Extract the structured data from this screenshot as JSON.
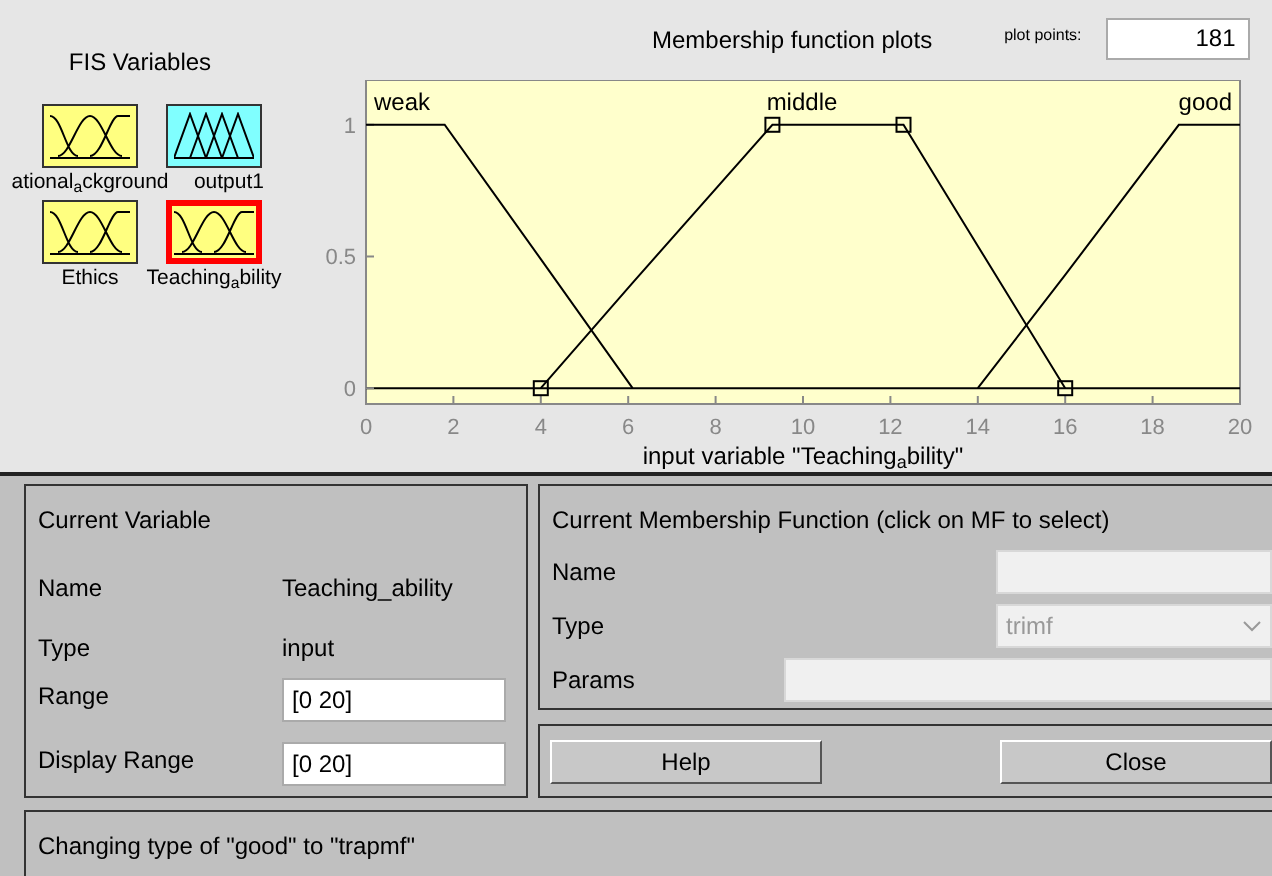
{
  "fis_variables": {
    "title": "FIS Variables",
    "items": [
      {
        "label": "ational$_{a}$ckground",
        "kind": "input",
        "selected": false
      },
      {
        "label": "output1",
        "kind": "output",
        "selected": false
      },
      {
        "label": "Ethics",
        "kind": "input",
        "selected": false
      },
      {
        "label": "Teaching$_{a}$bility",
        "kind": "input",
        "selected": true
      }
    ]
  },
  "plot": {
    "title": "Membership function plots",
    "membership_functions": [
      {
        "selected": false
      },
      {
        "selected": true
      },
      {
        "selected": false
      }
    ],
    "plot_points": {
      "label": "plot points:",
      "value": "181"
    },
    "chart_data": {
      "type": "line",
      "xlabel": "input variable \"Teaching$_{a}$bility\"",
      "x": [
        0,
        1.8,
        4,
        6.1,
        9.3,
        12.3,
        14,
        16,
        18.6,
        20
      ],
      "xlim": [
        0,
        20
      ],
      "ylim": [
        -0.06,
        1.17
      ],
      "xticks": [
        0,
        2,
        4,
        6,
        8,
        10,
        12,
        14,
        16,
        18,
        20
      ],
      "yticks": [
        0,
        0.5,
        1
      ],
      "series": [
        {
          "name": "weak",
          "color": "#000000",
          "values": [
            1,
            1,
            0.49,
            0,
            null,
            null,
            null,
            null,
            null,
            null
          ]
        },
        {
          "name": "middle",
          "color": "#000000",
          "values": [
            null,
            null,
            0,
            0.4,
            1,
            1,
            0.54,
            0,
            null,
            null
          ]
        },
        {
          "name": "good",
          "color": "#000000",
          "values": [
            null,
            null,
            null,
            null,
            null,
            null,
            0,
            0.43,
            1,
            1
          ]
        }
      ]
    }
  },
  "current_variable": {
    "title": "Current Variable",
    "name": {
      "label": "Name",
      "value": "Teaching_ability"
    },
    "type": {
      "label": "Type",
      "value": "input"
    },
    "range": {
      "label": "Range",
      "value": "[0 20]"
    },
    "display_range": {
      "label": "Display Range",
      "value": "[0 20]"
    }
  },
  "current_mf": {
    "title": "Current Membership Function (click on MF to select)",
    "name": {
      "label": "Name",
      "disabled": true
    },
    "type": {
      "label": "Type",
      "value": "trimf",
      "disabled": true
    },
    "params": {
      "label": "Params",
      "disabled": true
    }
  },
  "buttons": [
    "Help",
    "Close"
  ],
  "status": "Changing type of \"good\" to \"trapmf\""
}
